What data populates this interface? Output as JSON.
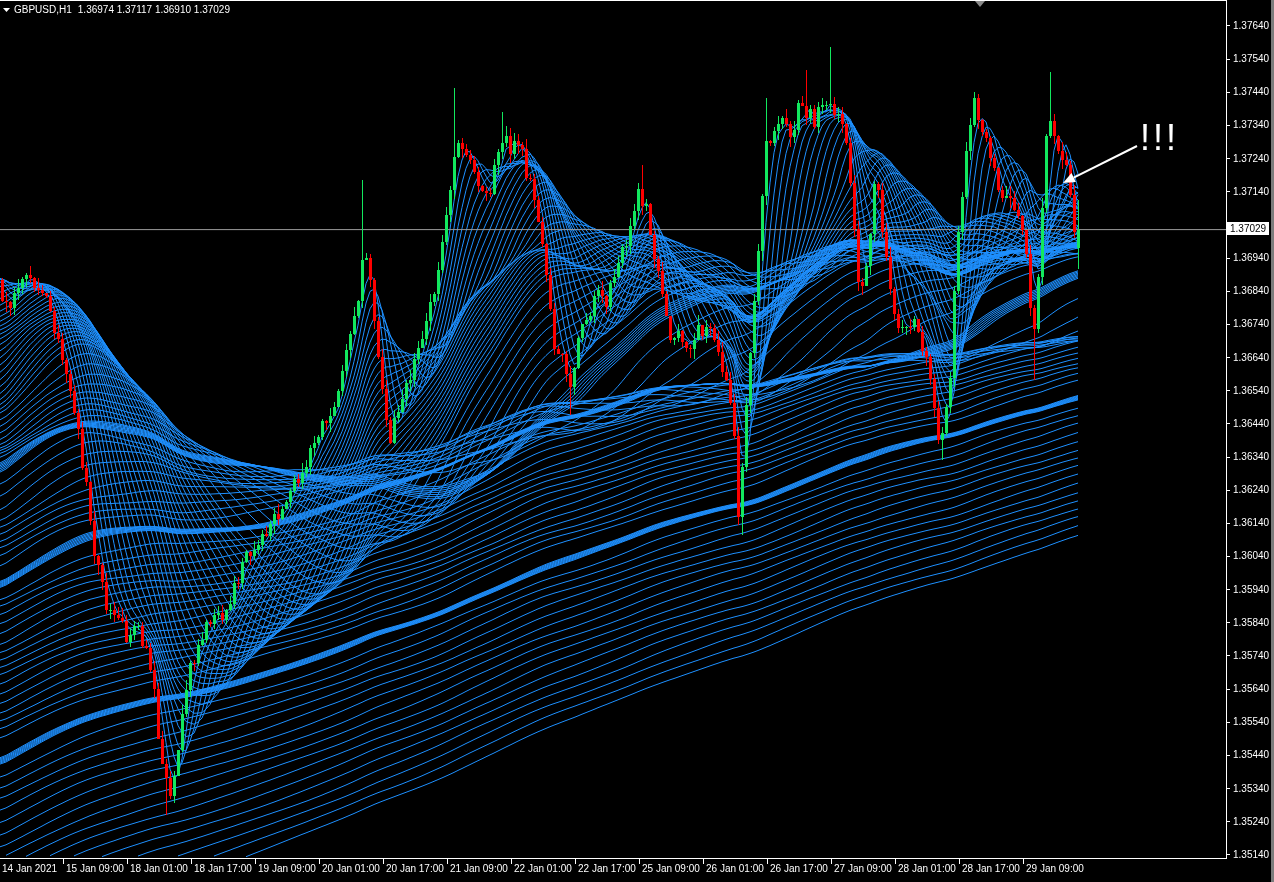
{
  "header": {
    "symbol": "GBPUSD,H1",
    "ohlc": "1.36974 1.37117 1.36910 1.37029"
  },
  "price_axis": {
    "labels_above": [
      "1.37640",
      "1.37540",
      "1.37440",
      "1.37340",
      "1.37240",
      "1.37140"
    ],
    "current_price": "1.37029",
    "labels_below": [
      "1.36940",
      "1.36840",
      "1.36740",
      "1.36640",
      "1.36540",
      "1.36440",
      "1.36340",
      "1.36240",
      "1.36140",
      "1.36040",
      "1.35940",
      "1.35840",
      "1.35740",
      "1.35640",
      "1.35540",
      "1.35440",
      "1.35340",
      "1.35240",
      "1.35140"
    ]
  },
  "time_axis": {
    "labels": [
      "14 Jan 2021",
      "15 Jan 09:00",
      "18 Jan 01:00",
      "18 Jan 17:00",
      "19 Jan 09:00",
      "20 Jan 01:00",
      "20 Jan 17:00",
      "21 Jan 09:00",
      "22 Jan 01:00",
      "22 Jan 17:00",
      "25 Jan 09:00",
      "26 Jan 01:00",
      "26 Jan 17:00",
      "27 Jan 09:00",
      "28 Jan 01:00",
      "28 Jan 17:00",
      "29 Jan 09:00"
    ]
  },
  "annotation": {
    "text": "!!!"
  }
}
